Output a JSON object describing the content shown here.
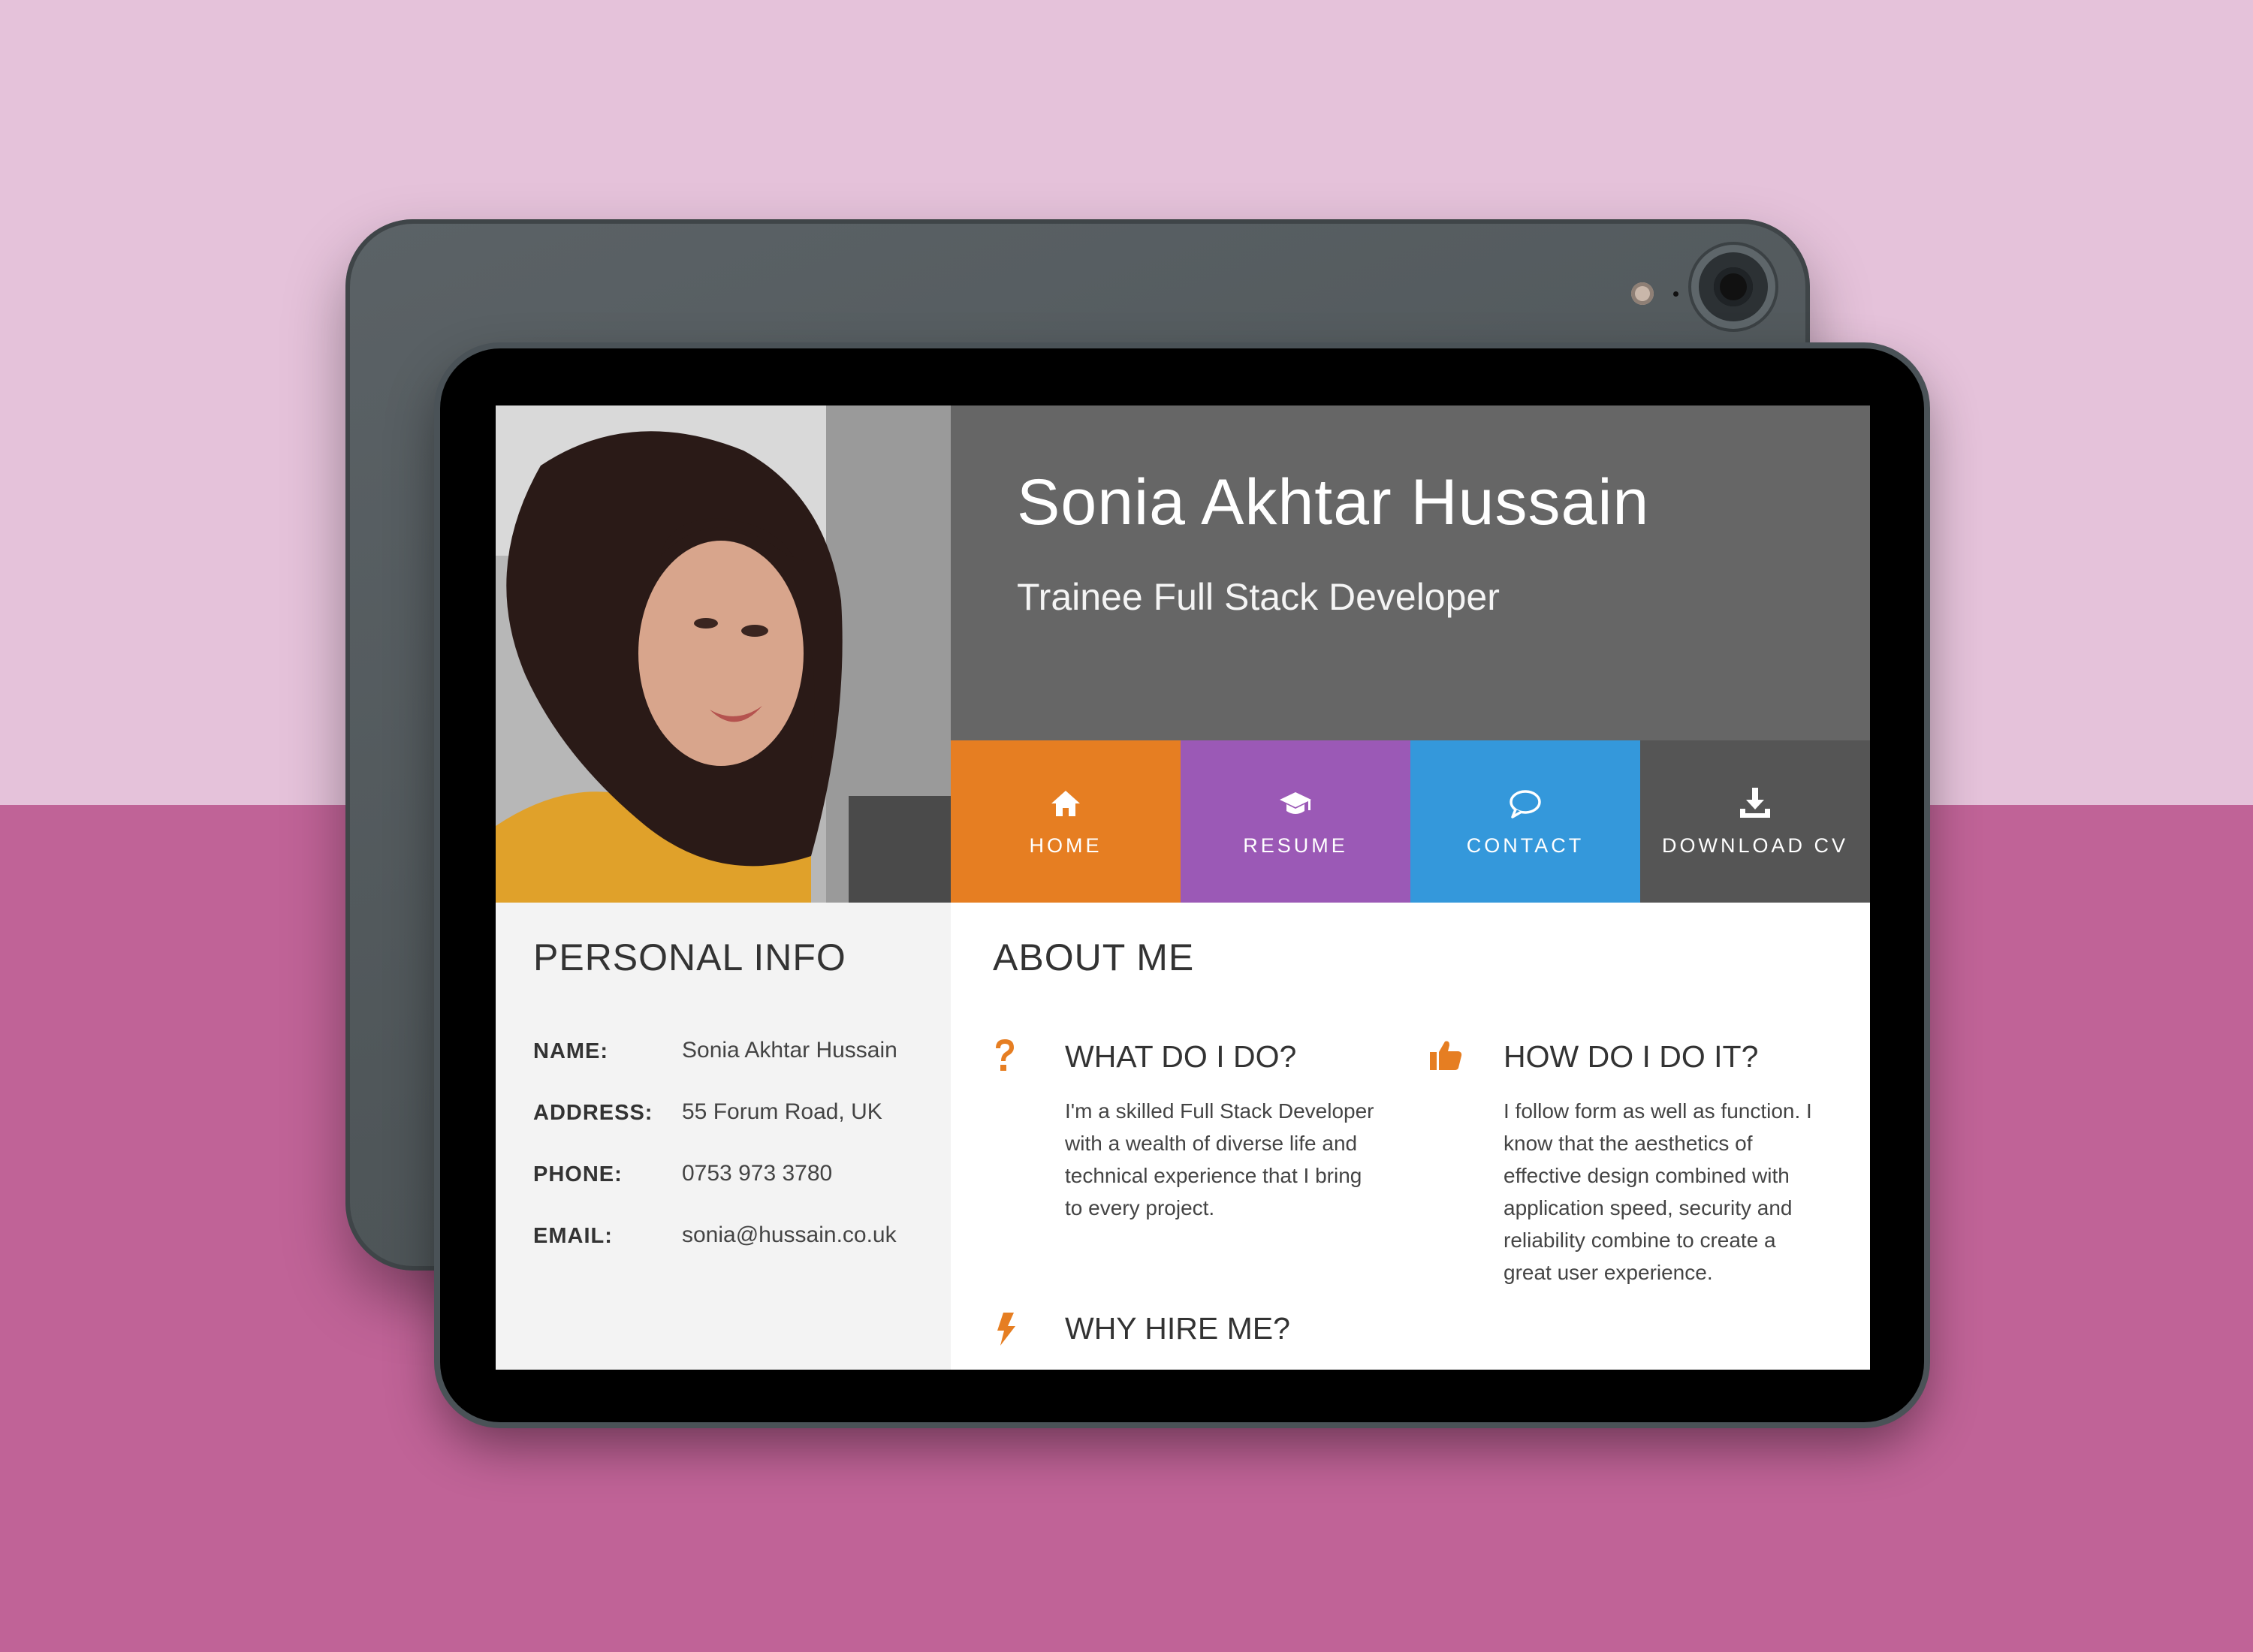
{
  "header": {
    "name": "Sonia Akhtar Hussain",
    "subtitle": "Trainee Full Stack Developer"
  },
  "nav": [
    {
      "label": "HOME",
      "icon": "home-icon",
      "color": "#e67e22"
    },
    {
      "label": "RESUME",
      "icon": "graduation-cap-icon",
      "color": "#9b59b6"
    },
    {
      "label": "CONTACT",
      "icon": "speech-bubble-icon",
      "color": "#3498db"
    },
    {
      "label": "DOWNLOAD CV",
      "icon": "download-icon",
      "color": "#555555"
    }
  ],
  "personal_info": {
    "title": "PERSONAL INFO",
    "rows": [
      {
        "label": "NAME:",
        "value": "Sonia Akhtar Hussain"
      },
      {
        "label": "ADDRESS:",
        "value": "55 Forum Road, UK"
      },
      {
        "label": "PHONE:",
        "value": "0753 973 3780"
      },
      {
        "label": "EMAIL:",
        "value": "sonia@hussain.co.uk"
      }
    ]
  },
  "about": {
    "title": "ABOUT ME",
    "features": [
      {
        "title": "WHAT DO I DO?",
        "icon": "question-mark-icon",
        "text": [
          "I'm a skilled Full Stack Developer",
          "with a wealth of diverse life and",
          "technical experience that I bring",
          "to every project."
        ]
      },
      {
        "title": "HOW DO I DO IT?",
        "icon": "thumbs-up-icon",
        "text": [
          "I follow form as well as function. I",
          "know that the aesthetics of",
          "effective design combined with",
          "application speed, security and",
          "reliability combine to create a",
          "great user experience."
        ]
      },
      {
        "title": "WHY HIRE ME?",
        "icon": "lightning-bolt-icon",
        "text": []
      }
    ]
  },
  "colors": {
    "accent": "#e67e22",
    "header_bg": "#666666",
    "background_top": "#e5c2da",
    "background_bottom": "#c06397"
  }
}
